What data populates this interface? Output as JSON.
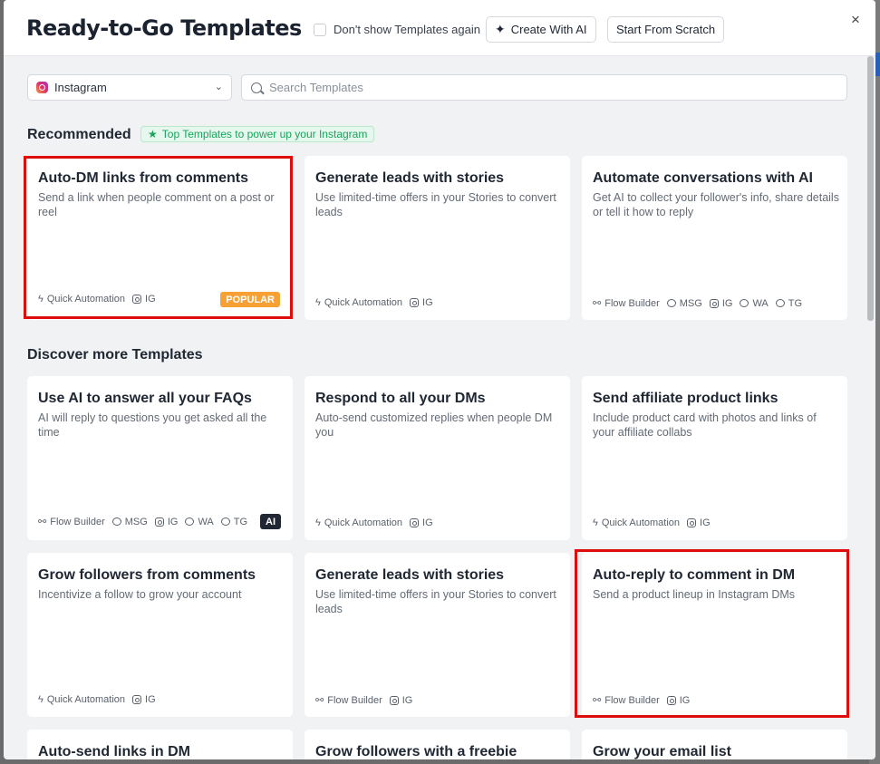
{
  "header": {
    "title": "Ready-to-Go Templates",
    "dont_show_label": "Don't show Templates again",
    "create_ai_label": "Create With AI",
    "scratch_label": "Start From Scratch",
    "close_glyph": "×"
  },
  "filters": {
    "channel": "Instagram",
    "search_placeholder": "Search Templates"
  },
  "recommended": {
    "title": "Recommended",
    "badge": "Top Templates to power up your Instagram",
    "cards": [
      {
        "title": "Auto-DM links from comments",
        "desc": "Send a link when people comment on a post or reel",
        "type": "Quick Automation",
        "channels": [
          "IG"
        ],
        "badge": "POPULAR",
        "highlighted": true
      },
      {
        "title": "Generate leads with stories",
        "desc": "Use limited-time offers in your Stories to convert leads",
        "type": "Quick Automation",
        "channels": [
          "IG"
        ]
      },
      {
        "title": "Automate conversations with AI",
        "desc": "Get AI to collect your follower's info, share details or tell it how to reply",
        "type": "Flow Builder",
        "channels": [
          "MSG",
          "IG",
          "WA",
          "TG"
        ]
      }
    ]
  },
  "discover": {
    "title": "Discover more Templates",
    "cards": [
      {
        "title": "Use AI to answer all your FAQs",
        "desc": "AI will reply to questions you get asked all the time",
        "type": "Flow Builder",
        "channels": [
          "MSG",
          "IG",
          "WA",
          "TG"
        ],
        "badge": "AI"
      },
      {
        "title": "Respond to all your DMs",
        "desc": "Auto-send customized replies when people DM you",
        "type": "Quick Automation",
        "channels": [
          "IG"
        ]
      },
      {
        "title": "Send affiliate product links",
        "desc": "Include product card with photos and links of your affiliate collabs",
        "type": "Quick Automation",
        "channels": [
          "IG"
        ]
      },
      {
        "title": "Grow followers from comments",
        "desc": "Incentivize a follow to grow your account",
        "type": "Quick Automation",
        "channels": [
          "IG"
        ]
      },
      {
        "title": "Generate leads with stories",
        "desc": "Use limited-time offers in your Stories to convert leads",
        "type": "Flow Builder",
        "channels": [
          "IG"
        ]
      },
      {
        "title": "Auto-reply to comment in DM",
        "desc": "Send a product lineup in Instagram DMs",
        "type": "Flow Builder",
        "channels": [
          "IG"
        ],
        "highlighted": true
      },
      {
        "title": "Auto-send links in DM"
      },
      {
        "title": "Grow followers with a freebie"
      },
      {
        "title": "Grow your email list"
      }
    ]
  },
  "colors": {
    "highlight": "#e00c0c",
    "popular": "#f7a033",
    "recommended_badge": "#1aa35c"
  }
}
